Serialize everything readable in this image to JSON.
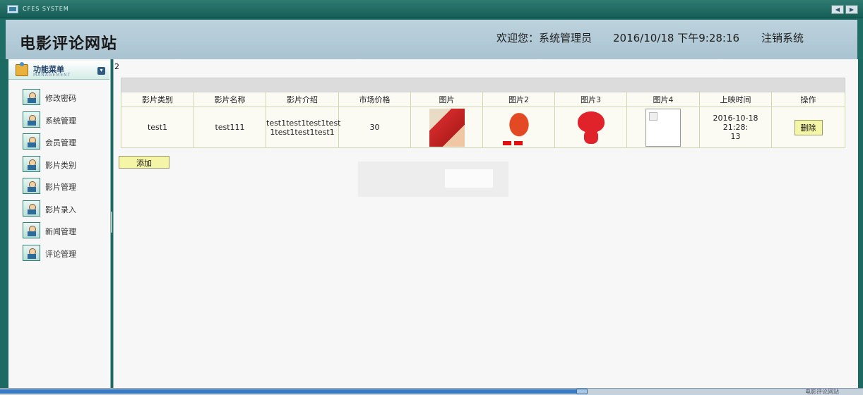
{
  "system": {
    "title": "CFES SYSTEM"
  },
  "header": {
    "site_title": "电影评论网站",
    "welcome": "欢迎您：系统管理员",
    "datetime": "2016/10/18 下午9:28:16",
    "logout": "注销系统"
  },
  "menu": {
    "title": "功能菜单",
    "subtitle": "MANAGEMENT",
    "items": [
      {
        "label": "修改密码"
      },
      {
        "label": "系统管理"
      },
      {
        "label": "会员管理"
      },
      {
        "label": "影片类别"
      },
      {
        "label": "影片管理"
      },
      {
        "label": "影片录入"
      },
      {
        "label": "新闻管理"
      },
      {
        "label": "评论管理"
      }
    ]
  },
  "content": {
    "page_number": "2",
    "columns": [
      "影片类别",
      "影片名称",
      "影片介绍",
      "市场价格",
      "图片",
      "图片2",
      "图片3",
      "图片4",
      "上映时间",
      "操作"
    ],
    "rows": [
      {
        "category": "test1",
        "name": "test111",
        "intro_line1": "test1test1test1test",
        "intro_line2": "1test1test1test1",
        "price": "30",
        "release_line1": "2016-10-18 21:28:",
        "release_line2": "13",
        "delete_label": "删除"
      }
    ],
    "add_label": "添加"
  },
  "status": {
    "text": "电影评论网站"
  }
}
